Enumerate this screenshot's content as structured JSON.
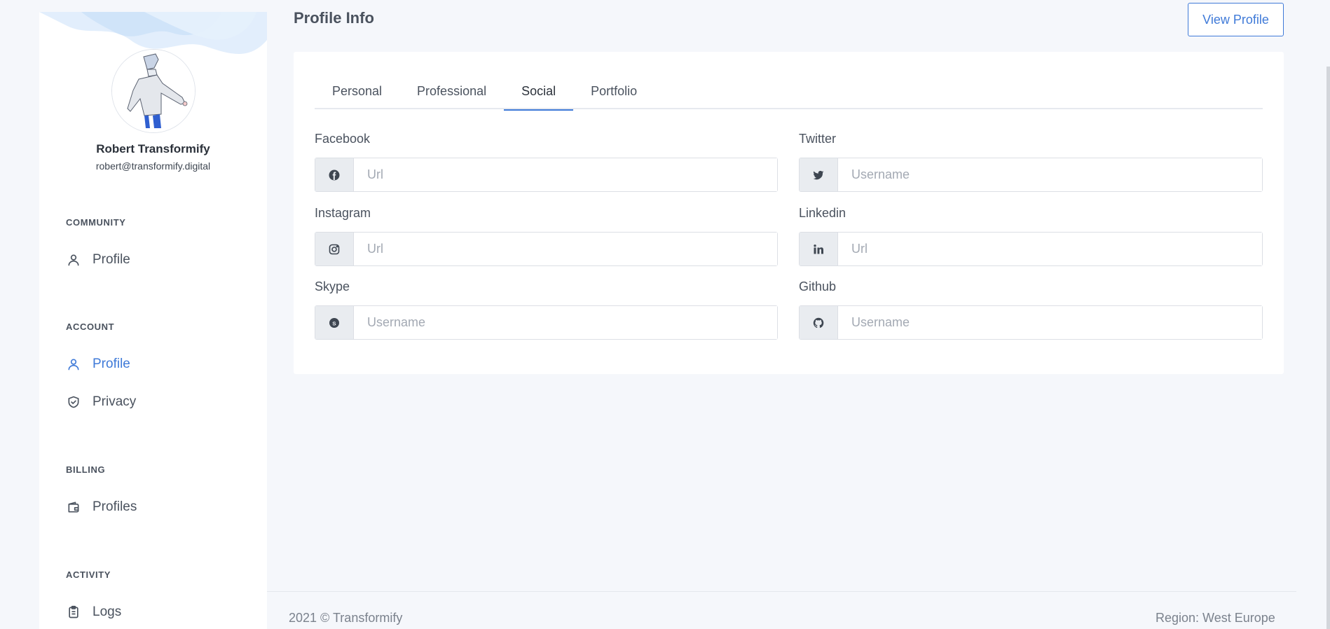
{
  "user": {
    "name": "Robert Transformify",
    "email": "robert@transformify.digital"
  },
  "sidebar": {
    "sections": [
      {
        "title": "COMMUNITY",
        "items": [
          {
            "label": "Profile",
            "icon": "user-icon",
            "active": false
          }
        ]
      },
      {
        "title": "ACCOUNT",
        "items": [
          {
            "label": "Profile",
            "icon": "user-icon",
            "active": true
          },
          {
            "label": "Privacy",
            "icon": "shield-check-icon",
            "active": false
          }
        ]
      },
      {
        "title": "BILLING",
        "items": [
          {
            "label": "Profiles",
            "icon": "wallet-icon",
            "active": false
          }
        ]
      },
      {
        "title": "ACTIVITY",
        "items": [
          {
            "label": "Logs",
            "icon": "clipboard-icon",
            "active": false
          }
        ]
      }
    ]
  },
  "header": {
    "title": "Profile Info",
    "view_profile_label": "View Profile"
  },
  "tabs": [
    {
      "label": "Personal",
      "active": false
    },
    {
      "label": "Professional",
      "active": false
    },
    {
      "label": "Social",
      "active": true
    },
    {
      "label": "Portfolio",
      "active": false
    }
  ],
  "social_fields": [
    {
      "label": "Facebook",
      "icon": "facebook-icon",
      "value": "",
      "placeholder": "Url"
    },
    {
      "label": "Twitter",
      "icon": "twitter-icon",
      "value": "",
      "placeholder": "Username"
    },
    {
      "label": "Instagram",
      "icon": "instagram-icon",
      "value": "",
      "placeholder": "Url"
    },
    {
      "label": "Linkedin",
      "icon": "linkedin-icon",
      "value": "",
      "placeholder": "Url"
    },
    {
      "label": "Skype",
      "icon": "skype-icon",
      "value": "",
      "placeholder": "Username"
    },
    {
      "label": "Github",
      "icon": "github-icon",
      "value": "",
      "placeholder": "Username"
    }
  ],
  "footer": {
    "copyright": "2021 © Transformify",
    "region": "Region: West Europe"
  },
  "colors": {
    "accent": "#3f7ad8",
    "background": "#f5f7fb",
    "addon": "#e9ecf0"
  }
}
